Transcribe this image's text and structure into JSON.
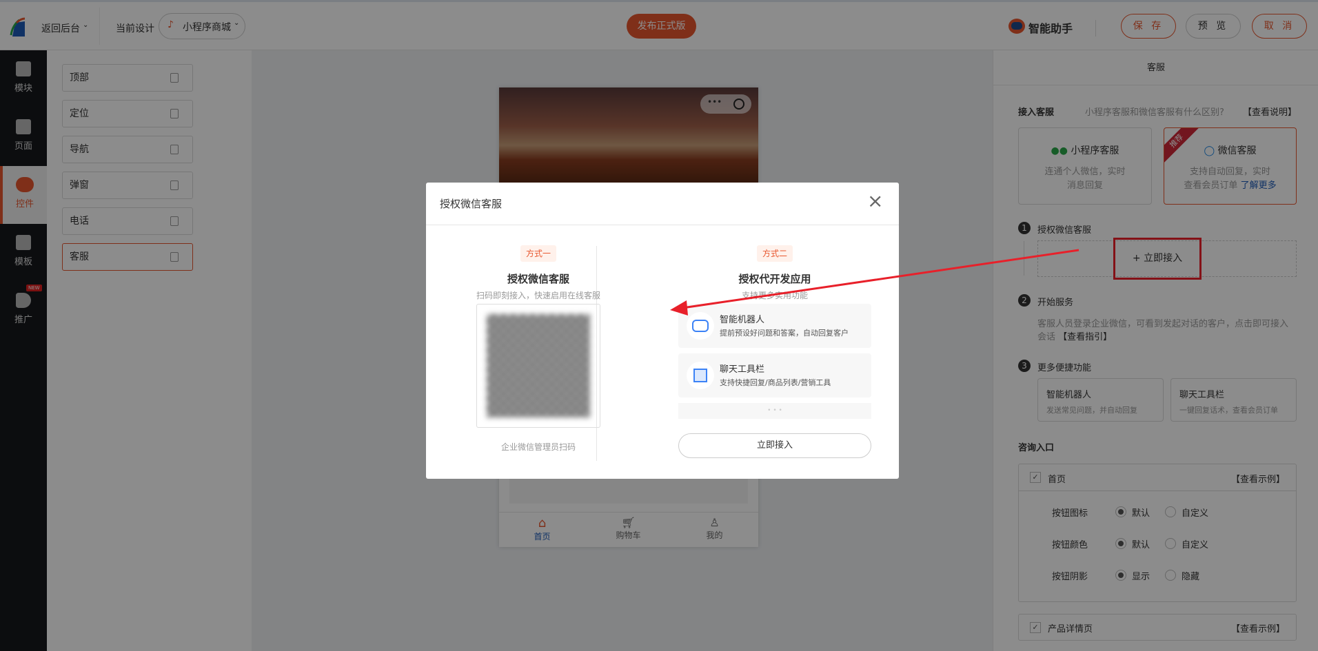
{
  "topbar": {
    "back": "返回后台",
    "current_label": "当前设计",
    "design": "小程序商城",
    "publish": "发布正式版",
    "assistant": "智能助手",
    "save": "保 存",
    "preview": "预 览",
    "cancel": "取 消"
  },
  "sidebar": [
    {
      "label": "模块"
    },
    {
      "label": "页面"
    },
    {
      "label": "控件"
    },
    {
      "label": "模板"
    },
    {
      "label": "推广",
      "badge": "NEW"
    }
  ],
  "components": [
    "顶部",
    "定位",
    "导航",
    "弹窗",
    "电话",
    "客服"
  ],
  "phone": {
    "tabs": [
      "首页",
      "购物车",
      "我的"
    ]
  },
  "right_panel": {
    "title": "客服",
    "access_label": "接入客服",
    "access_question": "小程序客服和微信客服有什么区别?",
    "access_link": "【查看说明】",
    "card1": {
      "title": "小程序客服",
      "desc1": "连通个人微信，实时",
      "desc2": "消息回复"
    },
    "card2": {
      "ribbon": "推荐",
      "title": "微信客服",
      "desc1": "支持自动回复，实时",
      "desc2": "查看会员订单",
      "link": "了解更多"
    },
    "step1": {
      "num": "1",
      "title": "授权微信客服",
      "button": "+ 立即接入"
    },
    "step2": {
      "num": "2",
      "title": "开始服务",
      "desc": "客服人员登录企业微信，可看到发起对话的客户，点击即可接入会话",
      "link": "【查看指引】"
    },
    "step3": {
      "num": "3",
      "title": "更多便捷功能",
      "f1": {
        "title": "智能机器人",
        "desc": "发送常见问题，并自动回复"
      },
      "f2": {
        "title": "聊天工具栏",
        "desc": "一键回复话术，查看会员订单"
      }
    },
    "entry": {
      "title": "咨询入口",
      "home": "首页",
      "example": "【查看示例】",
      "rows": [
        {
          "label": "按钮图标",
          "a": "默认",
          "b": "自定义"
        },
        {
          "label": "按钮颜色",
          "a": "默认",
          "b": "自定义"
        },
        {
          "label": "按钮阴影",
          "a": "显示",
          "b": "隐藏"
        }
      ],
      "detail": "产品详情页"
    }
  },
  "modal": {
    "title": "授权微信客服",
    "left": {
      "tag": "方式一",
      "title": "授权微信客服",
      "sub": "扫码即刻接入，快速启用在线客服",
      "caption": "企业微信管理员扫码"
    },
    "right": {
      "tag": "方式二",
      "title": "授权代开发应用",
      "sub": "支持更多实用功能",
      "f1": {
        "title": "智能机器人",
        "desc": "提前预设好问题和答案，自动回复客户"
      },
      "f2": {
        "title": "聊天工具栏",
        "desc": "支持快捷回复/商品列表/营销工具"
      },
      "more": "• • •",
      "button": "立即接入"
    }
  }
}
